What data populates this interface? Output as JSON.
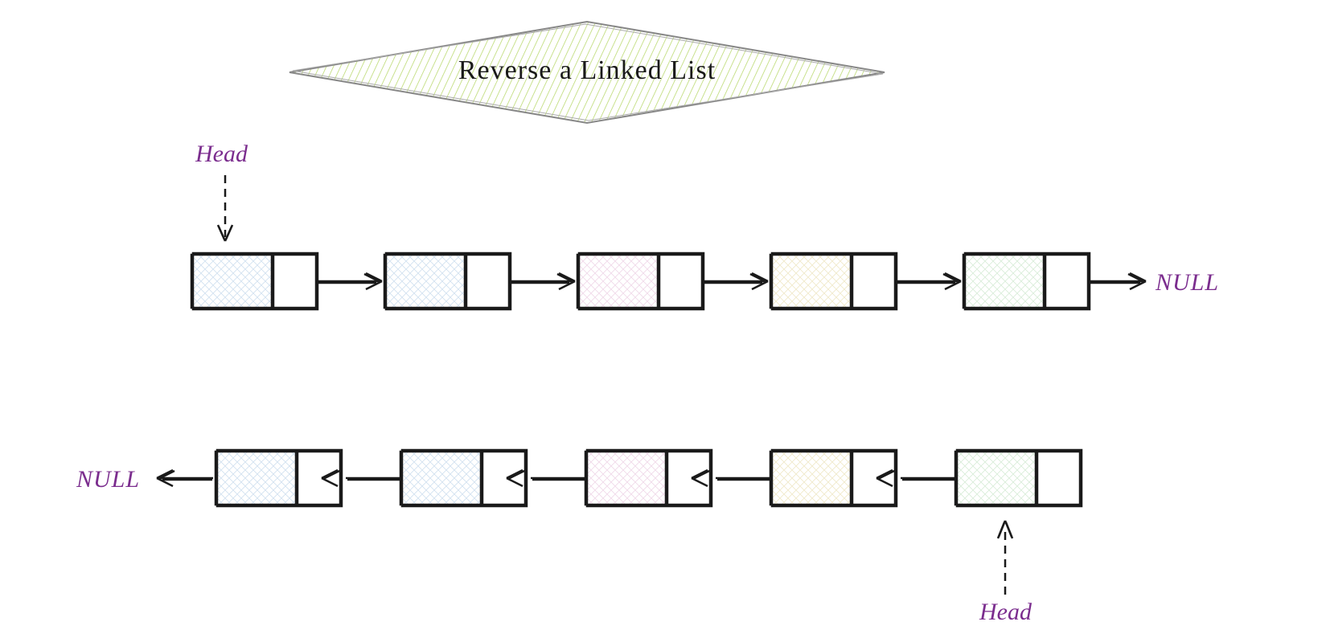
{
  "title": "Reverse a Linked List",
  "labels": {
    "head_top": "Head",
    "head_bottom": "Head",
    "null_right": "NULL",
    "null_left": "NULL"
  },
  "colors": {
    "title_fill": "#c8e08a",
    "title_stroke": "#888888",
    "node_stroke": "#1a1a1a",
    "label_color": "#7b2d8e",
    "node_fills": [
      "#e8f0f8",
      "#e8f0f8",
      "#f8e8f0",
      "#f8f4e0",
      "#e8f4e8"
    ]
  },
  "diagram": {
    "row1": {
      "head_index": 0,
      "null_side": "right",
      "arrow_direction": "right",
      "nodes": 5
    },
    "row2": {
      "head_index": 4,
      "null_side": "left",
      "arrow_direction": "left",
      "nodes": 5
    }
  }
}
